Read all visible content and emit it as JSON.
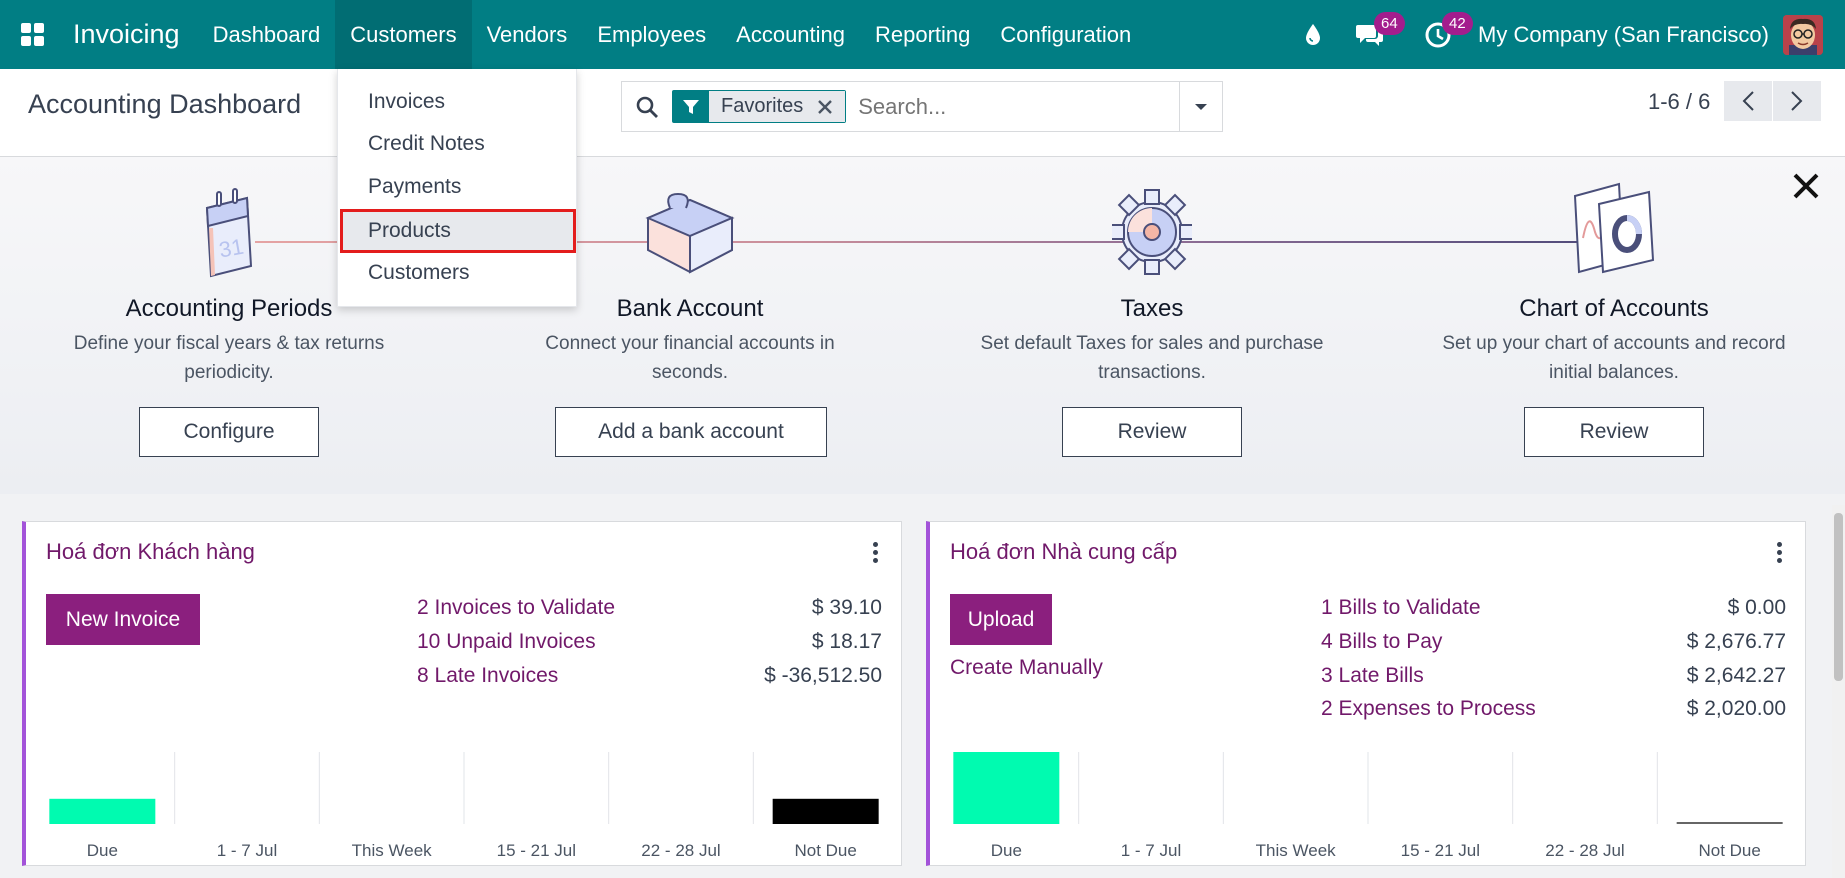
{
  "navbar": {
    "app_title": "Invoicing",
    "menu": [
      {
        "label": "Dashboard"
      },
      {
        "label": "Customers"
      },
      {
        "label": "Vendors"
      },
      {
        "label": "Employees"
      },
      {
        "label": "Accounting"
      },
      {
        "label": "Reporting"
      },
      {
        "label": "Configuration"
      }
    ],
    "active_menu": "Customers",
    "messages_count": "64",
    "activities_count": "42",
    "company": "My Company (San Francisco)",
    "colors": {
      "bar": "#017e84",
      "badge": "#a31d8d"
    }
  },
  "control_panel": {
    "title": "Accounting Dashboard",
    "facet_label": "Favorites",
    "search_placeholder": "Search...",
    "pager": "1-6 / 6"
  },
  "dropdown": {
    "items": [
      {
        "label": "Invoices"
      },
      {
        "label": "Credit Notes"
      },
      {
        "label": "Payments"
      },
      {
        "label": "Products"
      },
      {
        "label": "Customers"
      }
    ],
    "highlighted": "Products"
  },
  "onboarding": {
    "steps": [
      {
        "title": "Accounting Periods",
        "desc": "Define your fiscal years & tax returns periodicity.",
        "button": "Configure",
        "icon": "calendar-icon"
      },
      {
        "title": "Bank Account",
        "desc": "Connect your financial accounts in seconds.",
        "button": "Add a bank account",
        "icon": "puzzle-icon"
      },
      {
        "title": "Taxes",
        "desc": "Set default Taxes for sales and purchase transactions.",
        "button": "Review",
        "icon": "gear-icon"
      },
      {
        "title": "Chart of Accounts",
        "desc": "Set up your chart of accounts and record initial balances.",
        "button": "Review",
        "icon": "chart-icon"
      }
    ]
  },
  "journals": [
    {
      "title": "Hoá đơn Khách hàng",
      "primary_button": "New Invoice",
      "secondary_link": "",
      "stats": [
        {
          "label": "2 Invoices to Validate",
          "value": "$ 39.10"
        },
        {
          "label": "10 Unpaid Invoices",
          "value": "$ 18.17"
        },
        {
          "label": "8 Late Invoices",
          "value": "$ -36,512.50"
        }
      ]
    },
    {
      "title": "Hoá đơn Nhà cung cấp",
      "primary_button": "Upload",
      "secondary_link": "Create Manually",
      "stats": [
        {
          "label": "1 Bills to Validate",
          "value": "$ 0.00"
        },
        {
          "label": "4 Bills to Pay",
          "value": "$ 2,676.77"
        },
        {
          "label": "3 Late Bills",
          "value": "$ 2,642.27"
        },
        {
          "label": "2 Expenses to Process",
          "value": "$ 2,020.00"
        }
      ]
    }
  ],
  "chart_data": [
    {
      "type": "bar",
      "categories": [
        "Due",
        "1 - 7 Jul",
        "This Week",
        "15 - 21 Jul",
        "22 - 28 Jul",
        "Not Due"
      ],
      "values": [
        0.35,
        0,
        0,
        0,
        0,
        0.35
      ],
      "colors": [
        "#00fbb0",
        "#cccccc",
        "#cccccc",
        "#cccccc",
        "#cccccc",
        "#000000"
      ]
    },
    {
      "type": "bar",
      "categories": [
        "Due",
        "1 - 7 Jul",
        "This Week",
        "15 - 21 Jul",
        "22 - 28 Jul",
        "Not Due"
      ],
      "values": [
        1,
        0,
        0,
        0,
        0,
        0.02
      ],
      "colors": [
        "#00fbb0",
        "#cccccc",
        "#cccccc",
        "#cccccc",
        "#cccccc",
        "#666666"
      ]
    }
  ]
}
